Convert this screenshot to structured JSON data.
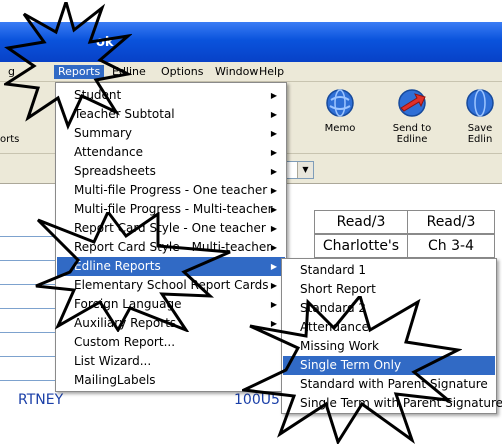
{
  "window": {
    "title_fragment": "ok"
  },
  "menubar": {
    "items": [
      {
        "label": "g"
      },
      {
        "label": "Reports",
        "active": true
      },
      {
        "label": "Edline"
      },
      {
        "label": "Options"
      },
      {
        "label": "Window"
      },
      {
        "label": "Help"
      }
    ]
  },
  "toolbar": {
    "left_fragment": "orts",
    "buttons": [
      {
        "label": "Memo",
        "icon": "memo-globe-icon"
      },
      {
        "label": "Send to\nEdline",
        "icon": "send-edline-icon"
      },
      {
        "label": "Save\nEdlin",
        "icon": "save-edline-icon"
      }
    ]
  },
  "grid": {
    "header_row": [
      "Read/3",
      "Read/3"
    ],
    "second_row": [
      "Charlotte's",
      "Ch 3-4"
    ],
    "student_name": "RTNEY",
    "student_id": "100U5"
  },
  "reports_menu": {
    "items": [
      {
        "label": "Student",
        "submenu": true
      },
      {
        "label": "Teacher Subtotal",
        "submenu": true
      },
      {
        "label": "Summary",
        "submenu": true
      },
      {
        "label": "Attendance",
        "submenu": true
      },
      {
        "label": "Spreadsheets",
        "submenu": true
      },
      {
        "label": "Multi-file Progress - One teacher",
        "submenu": true
      },
      {
        "label": "Multi-file Progress - Multi-teacher",
        "submenu": true
      },
      {
        "label": "Report Card Style - One teacher",
        "submenu": true
      },
      {
        "label": "Report Card Style - Multi-teacher",
        "submenu": true
      },
      {
        "label": "Edline Reports",
        "submenu": true,
        "highlighted": true
      },
      {
        "label": "Elementary School Report Cards",
        "submenu": true
      },
      {
        "label": "Foreign Language",
        "submenu": true
      },
      {
        "label": "Auxiliary Reports",
        "submenu": true
      },
      {
        "label": "Custom Report...",
        "submenu": false
      },
      {
        "label": "List Wizard...",
        "submenu": false
      },
      {
        "label": "MailingLabels",
        "submenu": false
      }
    ]
  },
  "edline_submenu": {
    "items": [
      {
        "label": "Standard 1"
      },
      {
        "label": "Short Report"
      },
      {
        "label": "Standard 2"
      },
      {
        "label": "Attendance"
      },
      {
        "label": "Missing Work"
      },
      {
        "label": "Single Term Only",
        "highlighted": true
      },
      {
        "label": "Standard with Parent Signature"
      },
      {
        "label": "Single Term with Parent Signature"
      }
    ]
  },
  "colors": {
    "titlebar": "#0a53dc",
    "menu_highlight": "#316ac5",
    "menubar_bg": "#ece9d8"
  }
}
